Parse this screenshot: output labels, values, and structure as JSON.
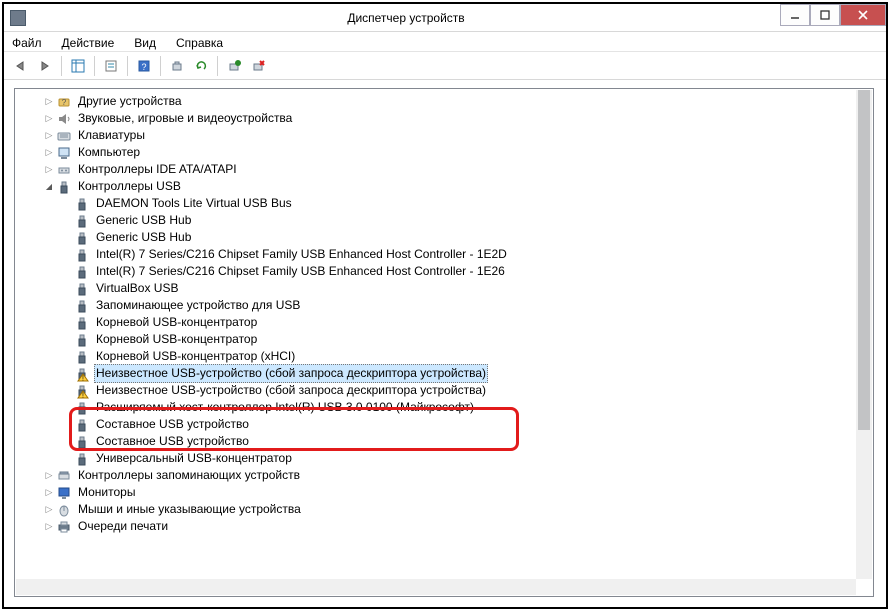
{
  "window": {
    "title": "Диспетчер устройств"
  },
  "menu": {
    "file": "Файл",
    "action": "Действие",
    "view": "Вид",
    "help": "Справка"
  },
  "tree": {
    "cat_other": "Другие устройства",
    "cat_audio": "Звуковые, игровые и видеоустройства",
    "cat_keyboard": "Клавиатуры",
    "cat_computer": "Компьютер",
    "cat_ide": "Контроллеры IDE ATA/ATAPI",
    "cat_usb": "Контроллеры USB",
    "cat_storage": "Контроллеры запоминающих устройств",
    "cat_monitors": "Мониторы",
    "cat_mice": "Мыши и иные указывающие устройства",
    "cat_print": "Очереди печати",
    "usb": {
      "daemon": "DAEMON Tools Lite Virtual USB Bus",
      "generic1": "Generic USB Hub",
      "generic2": "Generic USB Hub",
      "intel1": "Intel(R) 7 Series/C216 Chipset Family USB Enhanced Host Controller - 1E2D",
      "intel2": "Intel(R) 7 Series/C216 Chipset Family USB Enhanced Host Controller - 1E26",
      "vbox": "VirtualBox USB",
      "mass": "Запоминающее устройство для USB",
      "root1": "Корневой USB-концентратор",
      "root2": "Корневой USB-концентратор",
      "root3": "Корневой USB-концентратор (xHCI)",
      "unknown1": "Неизвестное USB-устройство (сбой запроса дескриптора устройства)",
      "unknown2": "Неизвестное USB-устройство (сбой запроса дескриптора устройства)",
      "xhci": "Расширяемый хост-контроллер Intel(R) USB 3.0 0100 (Майкрософт)",
      "comp1": "Составное USB устройство",
      "comp2": "Составное USB устройство",
      "univhub": "Универсальный USB-концентратор"
    }
  }
}
